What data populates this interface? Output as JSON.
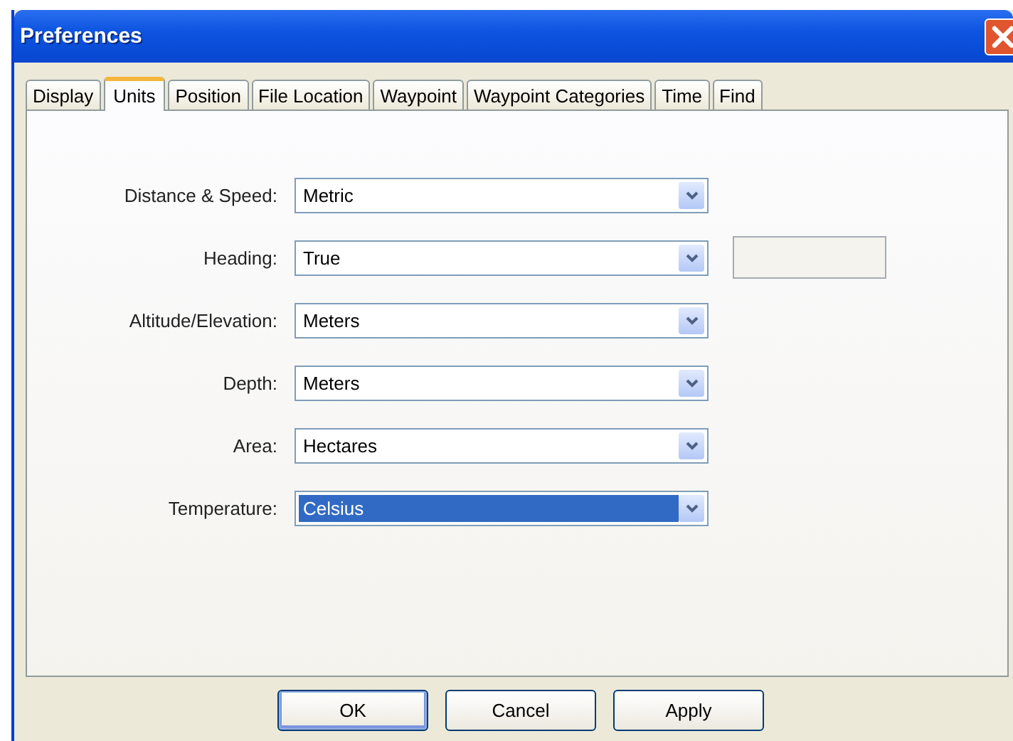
{
  "window": {
    "title": "Preferences"
  },
  "tabs": [
    {
      "label": "Display",
      "selected": false
    },
    {
      "label": "Units",
      "selected": true
    },
    {
      "label": "Position",
      "selected": false
    },
    {
      "label": "File Location",
      "selected": false
    },
    {
      "label": "Waypoint",
      "selected": false
    },
    {
      "label": "Waypoint Categories",
      "selected": false
    },
    {
      "label": "Time",
      "selected": false
    },
    {
      "label": "Find",
      "selected": false
    }
  ],
  "settings": [
    {
      "label": "Distance & Speed:",
      "value": "Metric",
      "focused": false,
      "side_field": false
    },
    {
      "label": "Heading:",
      "value": "True",
      "focused": false,
      "side_field": true
    },
    {
      "label": "Altitude/Elevation:",
      "value": "Meters",
      "focused": false,
      "side_field": false
    },
    {
      "label": "Depth:",
      "value": "Meters",
      "focused": false,
      "side_field": false
    },
    {
      "label": "Area:",
      "value": "Hectares",
      "focused": false,
      "side_field": false
    },
    {
      "label": "Temperature:",
      "value": "Celsius",
      "focused": true,
      "side_field": false
    }
  ],
  "buttons": [
    {
      "label": "OK",
      "default": true
    },
    {
      "label": "Cancel",
      "default": false
    },
    {
      "label": "Apply",
      "default": false
    }
  ]
}
